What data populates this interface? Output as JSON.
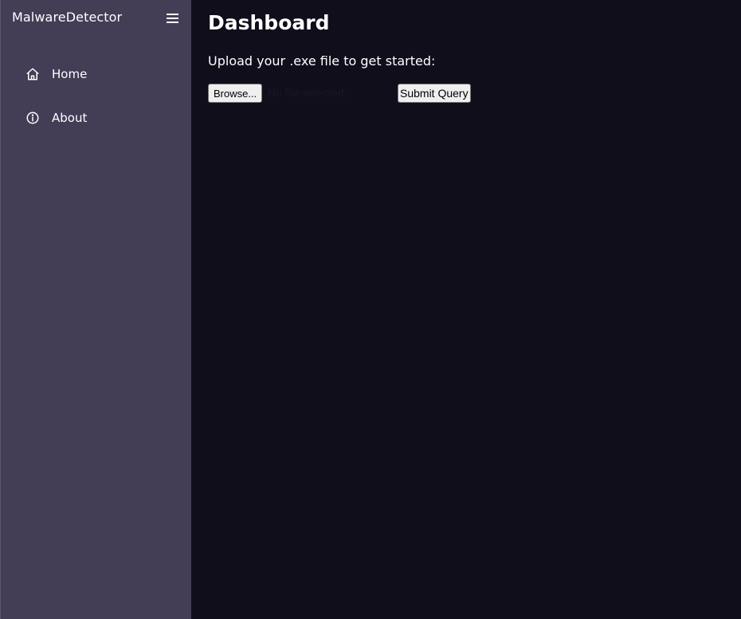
{
  "sidebar": {
    "brand": "MalwareDetector",
    "menu_icon": "hamburger-menu-icon",
    "items": [
      {
        "label": "Home",
        "icon": "home-icon"
      },
      {
        "label": "About",
        "icon": "info-icon"
      }
    ]
  },
  "main": {
    "title": "Dashboard",
    "subtitle": "Upload your .exe file to get started:",
    "upload": {
      "browse_label": "Browse...",
      "file_status": "No file selected.",
      "submit_label": "Submit Query"
    }
  },
  "colors": {
    "sidebar_bg": "#433d56",
    "main_bg": "#110e1b",
    "text": "#ffffff"
  }
}
